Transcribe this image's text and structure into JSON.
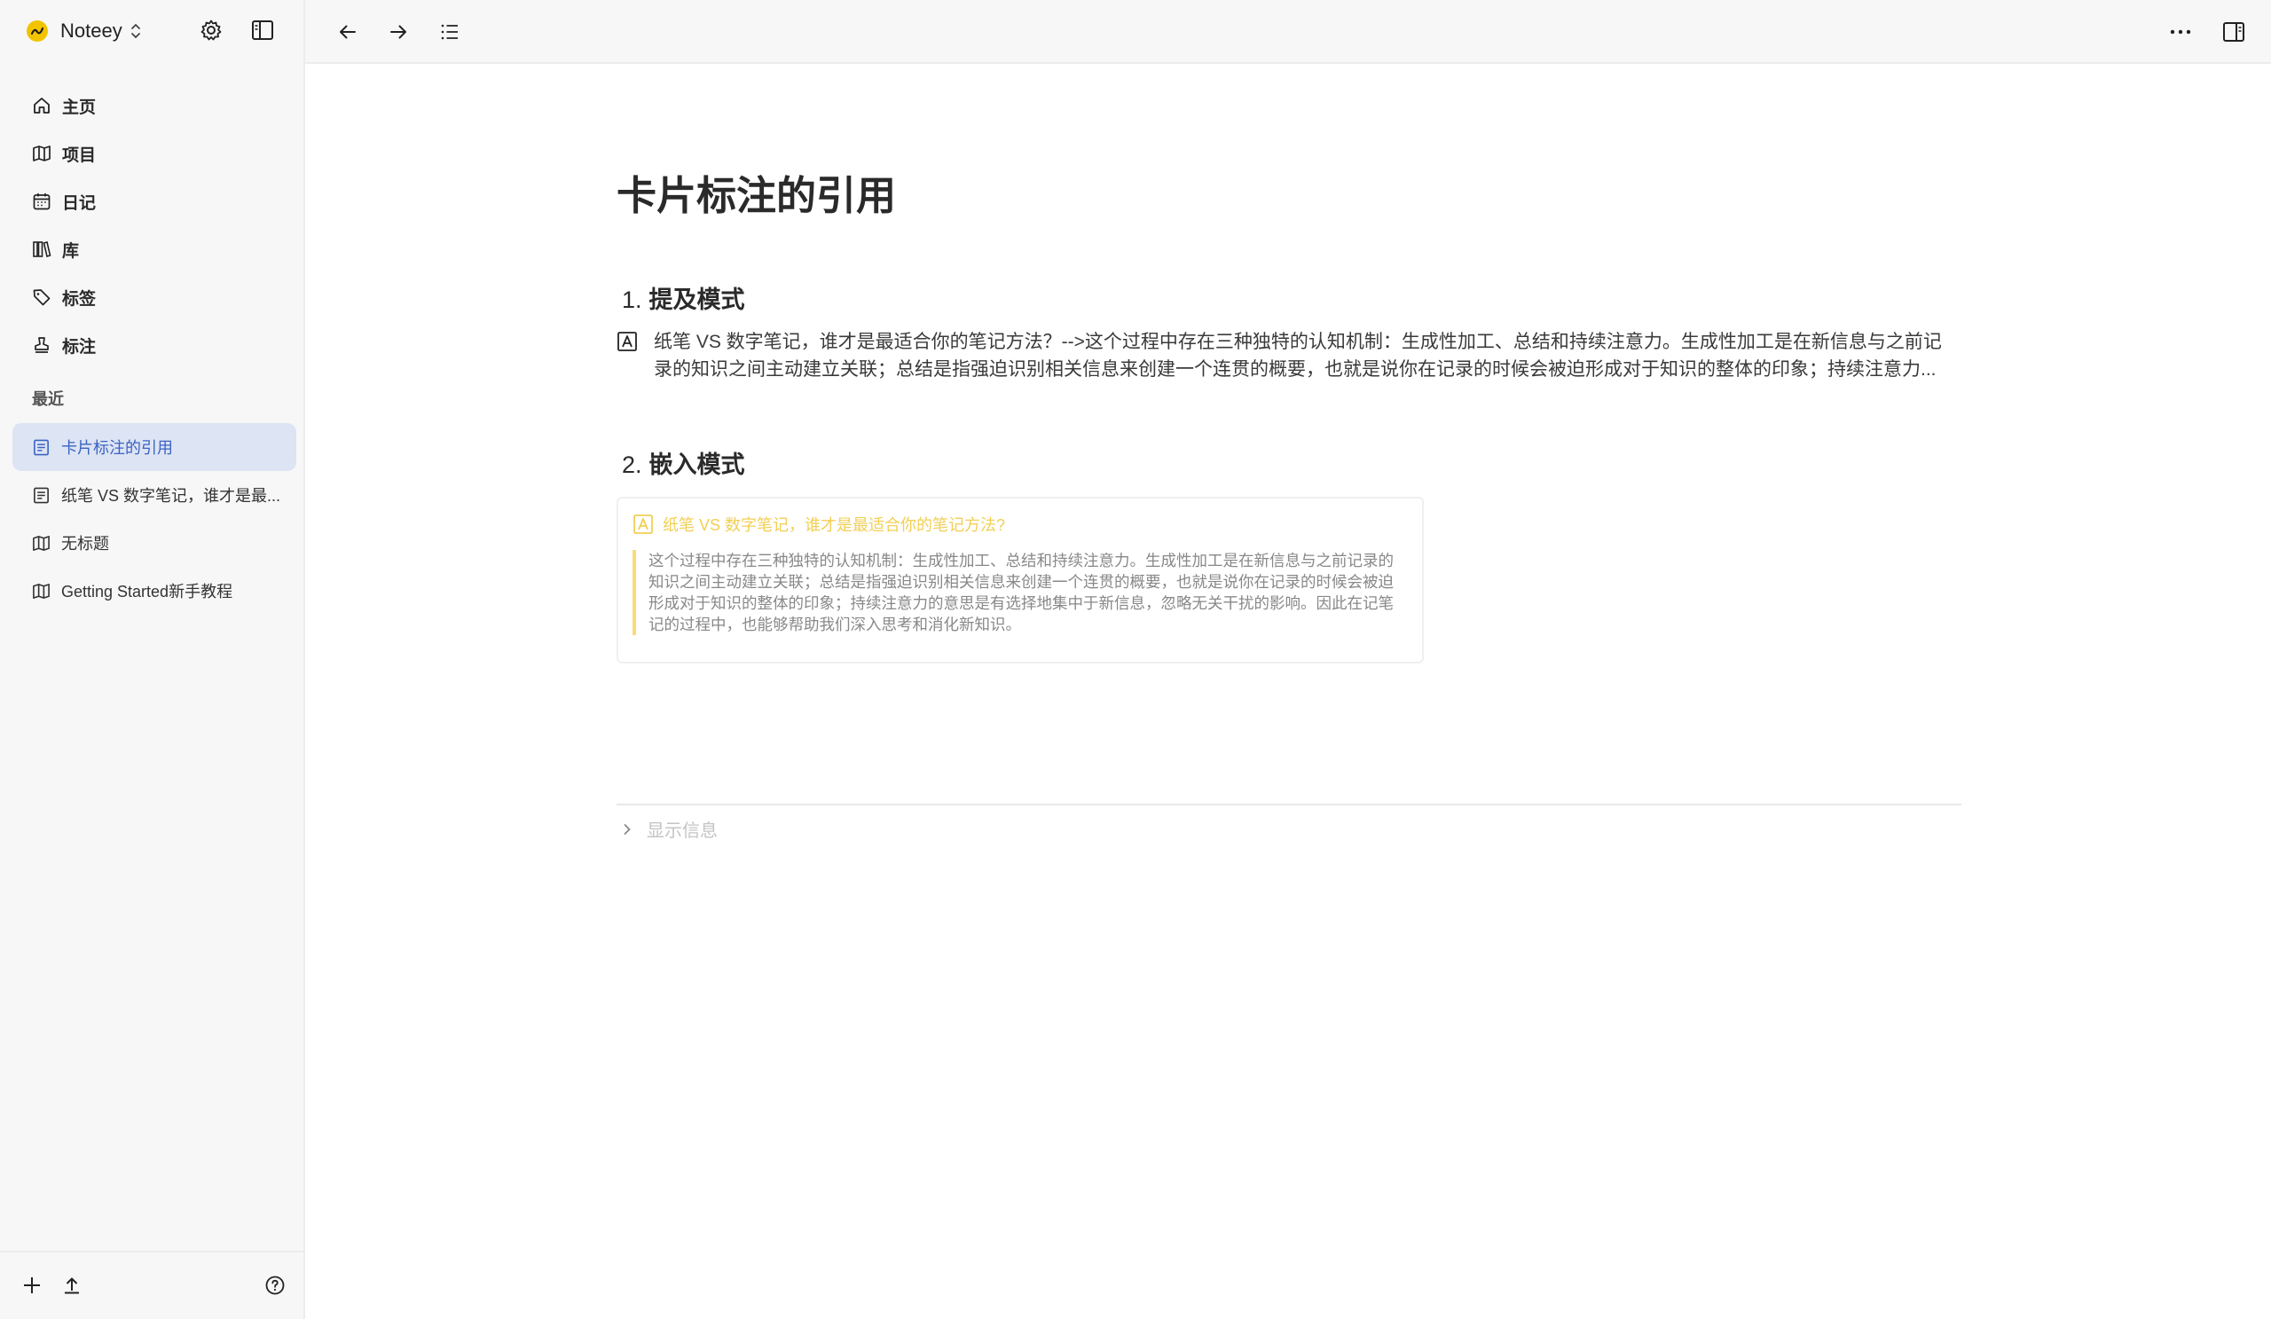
{
  "app": {
    "name": "Noteey"
  },
  "sidebar": {
    "nav": [
      {
        "label": "主页",
        "icon": "home-icon"
      },
      {
        "label": "项目",
        "icon": "map-icon"
      },
      {
        "label": "日记",
        "icon": "calendar-icon"
      },
      {
        "label": "库",
        "icon": "library-icon"
      },
      {
        "label": "标签",
        "icon": "tag-icon"
      },
      {
        "label": "标注",
        "icon": "stamp-icon"
      }
    ],
    "recent_label": "最近",
    "recent": [
      {
        "label": "卡片标注的引用",
        "icon": "document-icon",
        "active": true
      },
      {
        "label": "纸笔 VS 数字笔记，谁才是最...",
        "icon": "document-icon",
        "active": false
      },
      {
        "label": "无标题",
        "icon": "map-icon",
        "active": false
      },
      {
        "label": "Getting Started新手教程",
        "icon": "map-icon",
        "active": false
      }
    ]
  },
  "document": {
    "title": "卡片标注的引用",
    "section1": {
      "number": "1.",
      "heading": "提及模式"
    },
    "mention_text": "纸笔 VS 数字笔记，谁才是最适合你的笔记方法？-->这个过程中存在三种独特的认知机制：生成性加工、总结和持续注意力。生成性加工是在新信息与之前记录的知识之间主动建立关联；总结是指强迫识别相关信息来创建一个连贯的概要，也就是说你在记录的时候会被迫形成对于知识的整体的印象；持续注意力...",
    "section2": {
      "number": "2.",
      "heading": "嵌入模式"
    },
    "embed": {
      "title": "纸笔 VS 数字笔记，谁才是最适合你的笔记方法?",
      "body": "这个过程中存在三种独特的认知机制：生成性加工、总结和持续注意力。生成性加工是在新信息与之前记录的知识之间主动建立关联；总结是指强迫识别相关信息来创建一个连贯的概要，也就是说你在记录的时候会被迫形成对于知识的整体的印象；持续注意力的意思是有选择地集中于新信息，忽略无关干扰的影响。因此在记笔记的过程中，也能够帮助我们深入思考和消化新知识。"
    },
    "show_info": "显示信息"
  },
  "colors": {
    "accent": "#3b63c4",
    "active_bg": "#dde4f3",
    "embed_yellow": "#f2cf55",
    "logo": "#f2c400"
  }
}
